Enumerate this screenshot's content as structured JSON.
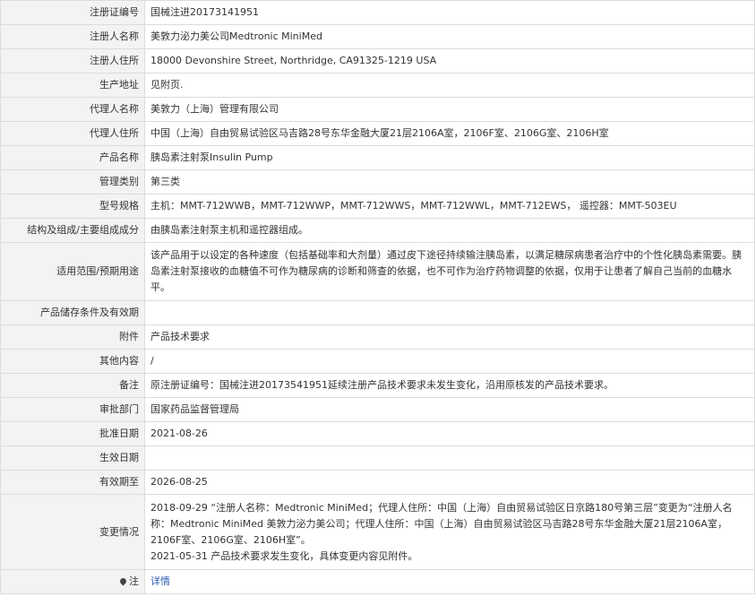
{
  "rows": [
    {
      "label": "注册证编号",
      "value": "国械注进20173141951"
    },
    {
      "label": "注册人名称",
      "value": "美敦力泌力美公司Medtronic MiniMed"
    },
    {
      "label": "注册人住所",
      "value": "18000 Devonshire Street, Northridge, CA91325-1219 USA"
    },
    {
      "label": "生产地址",
      "value": "见附页."
    },
    {
      "label": "代理人名称",
      "value": "美敦力（上海）管理有限公司"
    },
    {
      "label": "代理人住所",
      "value": "中国（上海）自由贸易试验区马吉路28号东华金融大厦21层2106A室，2106F室、2106G室、2106H室"
    },
    {
      "label": "产品名称",
      "value": "胰岛素注射泵Insulin Pump"
    },
    {
      "label": "管理类别",
      "value": "第三类"
    },
    {
      "label": "型号规格",
      "value": "主机：MMT-712WWB，MMT-712WWP，MMT-712WWS，MMT-712WWL，MMT-712EWS， 遥控器：MMT-503EU"
    },
    {
      "label": "结构及组成/主要组成成分",
      "value": "由胰岛素注射泵主机和遥控器组成。"
    },
    {
      "label": "适用范围/预期用途",
      "value": "该产品用于以设定的各种速度（包括基础率和大剂量）通过皮下途径持续输注胰岛素，以满足糖尿病患者治疗中的个性化胰岛素需要。胰岛素注射泵接收的血糖值不可作为糖尿病的诊断和筛查的依据，也不可作为治疗药物调整的依据，仅用于让患者了解自己当前的血糖水平。"
    },
    {
      "label": "产品储存条件及有效期",
      "value": ""
    },
    {
      "label": "附件",
      "value": "产品技术要求"
    },
    {
      "label": "其他内容",
      "value": "/"
    },
    {
      "label": "备注",
      "value": "原注册证编号：国械注进20173541951延续注册产品技术要求未发生变化，沿用原核发的产品技术要求。"
    },
    {
      "label": "审批部门",
      "value": "国家药品监督管理局"
    },
    {
      "label": "批准日期",
      "value": "2021-08-26"
    },
    {
      "label": "生效日期",
      "value": ""
    },
    {
      "label": "有效期至",
      "value": "2026-08-25"
    }
  ],
  "changes": {
    "label": "变更情况",
    "line1": "2018-09-29 “注册人名称：Medtronic MiniMed；代理人住所：中国（上海）自由贸易试验区日京路180号第三层”变更为“注册人名称：Medtronic MiniMed 美敦力泌力美公司；代理人住所：中国（上海）自由贸易试验区马吉路28号东华金融大厦21层2106A室，2106F室、2106G室、2106H室”。",
    "line2": "2021-05-31 产品技术要求发生变化，具体变更内容见附件。"
  },
  "note": {
    "label": "注",
    "icon": "location-pin-icon",
    "link": "详情"
  }
}
